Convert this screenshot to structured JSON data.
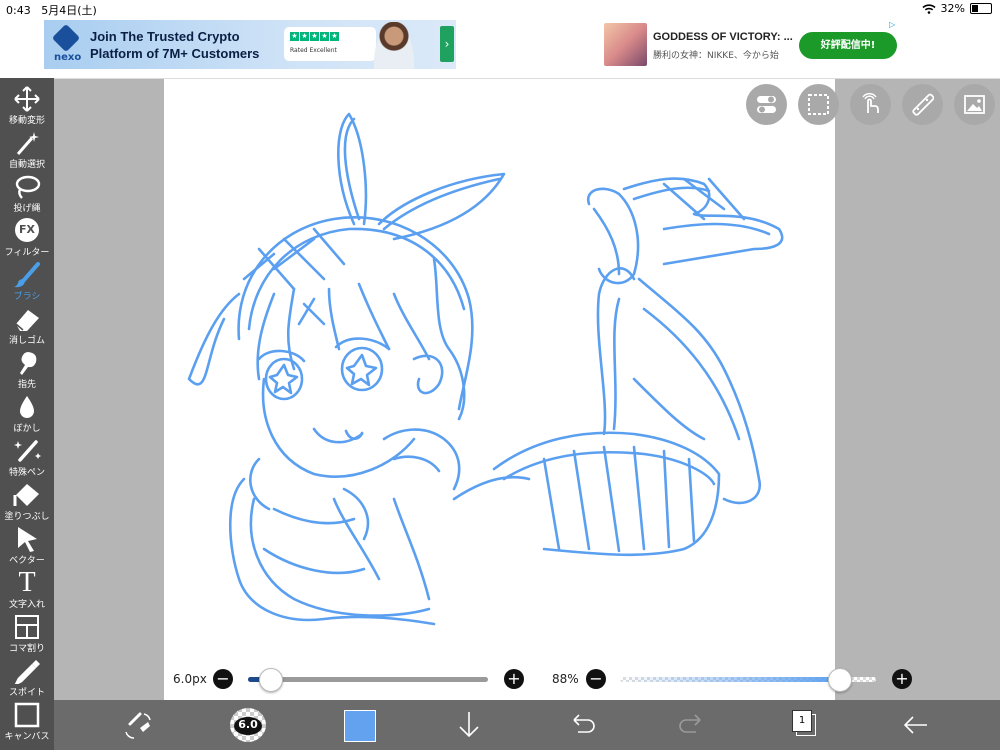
{
  "status": {
    "time": "0:43",
    "date": "5月4日(土)",
    "battery": "32%"
  },
  "ads": {
    "ad1": {
      "brand": "nexo",
      "headline": "Join The Trusted Crypto Platform of 7M+ Customers",
      "rated": "Rated Excellent",
      "arrow": "›"
    },
    "ad2": {
      "title": "GODDESS OF VICTORY: ...",
      "desc": "勝利の女神：NIKKE、今から始",
      "cta": "好評配信中!",
      "adchoice": "▷"
    }
  },
  "toolbar": {
    "items": [
      {
        "label": "移動変形",
        "icon": "move-icon"
      },
      {
        "label": "自動選択",
        "icon": "magic-wand-icon"
      },
      {
        "label": "投げ縄",
        "icon": "lasso-icon"
      },
      {
        "label": "フィルター",
        "icon": "fx-icon",
        "glyph": "FX"
      },
      {
        "label": "ブラシ",
        "icon": "brush-icon",
        "active": true
      },
      {
        "label": "消しゴム",
        "icon": "eraser-icon"
      },
      {
        "label": "指先",
        "icon": "finger-icon"
      },
      {
        "label": "ぼかし",
        "icon": "blur-drop-icon"
      },
      {
        "label": "特殊ペン",
        "icon": "special-pen-icon"
      },
      {
        "label": "塗りつぶし",
        "icon": "fill-bucket-icon"
      },
      {
        "label": "ベクター",
        "icon": "vector-cursor-icon"
      },
      {
        "label": "文字入れ",
        "icon": "text-icon",
        "glyph": "T"
      },
      {
        "label": "コマ割り",
        "icon": "panel-divide-icon"
      },
      {
        "label": "スポイト",
        "icon": "eyedropper-icon"
      },
      {
        "label": "キャンバス",
        "icon": "canvas-icon"
      }
    ],
    "accent": "#4a9fe8"
  },
  "sliders": {
    "brush_size": "6.0px",
    "opacity": "88%",
    "size_level": 0.04,
    "opacity_level": 0.88,
    "minus": "−",
    "plus": "+"
  },
  "bottom": {
    "brush_size_badge": "6.0",
    "layer_count": "1",
    "color": "#62a2ee"
  },
  "colors": {
    "stroke": "#5b9ff0"
  }
}
